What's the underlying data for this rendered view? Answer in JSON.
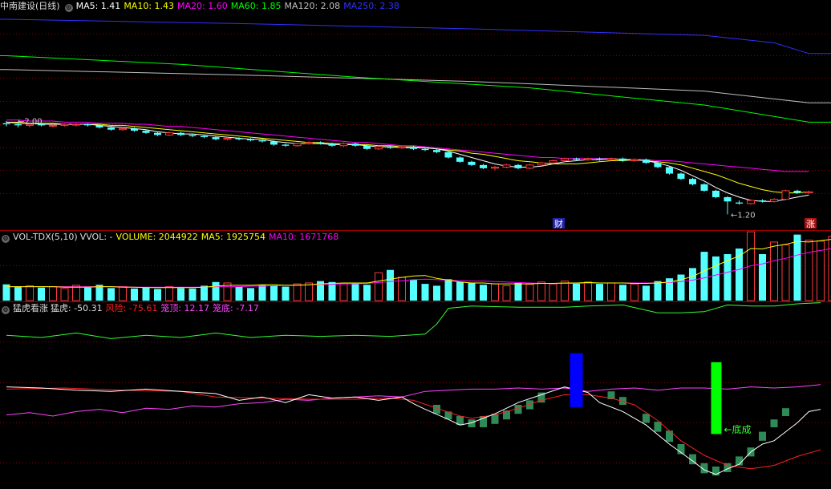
{
  "colors": {
    "up": "#ff3b3b",
    "down": "#54ffff",
    "ma5": "#ffffff",
    "ma10": "#ffff00",
    "ma20": "#ff00ff",
    "ma60": "#00ff00",
    "ma120": "#c0c0c0",
    "ma250": "#3030ff",
    "grid": "#8b0000",
    "risk": "#ff2020",
    "top": "#ff44ff",
    "bottom": "#30ff30",
    "tiger": "#ffffff",
    "bar_green": "#2e8b57",
    "blue_block": "#0000ff",
    "green_block": "#00ff00"
  },
  "price_panel": {
    "title": "中南建设(日线)",
    "ma_labels": [
      {
        "key": "ma5",
        "text": "MA5: 1.41"
      },
      {
        "key": "ma10",
        "text": "MA10: 1.43"
      },
      {
        "key": "ma20",
        "text": "MA20: 1.60"
      },
      {
        "key": "ma60",
        "text": "MA60: 1.85"
      },
      {
        "key": "ma120",
        "text": "MA120: 2.08"
      },
      {
        "key": "ma250",
        "text": "MA250: 2.38"
      }
    ],
    "high_label": "2.00",
    "low_label": "1.20",
    "marker_cai": "财",
    "marker_zhang": "涨",
    "ma250_line": [
      [
        0,
        3.02
      ],
      [
        20,
        2.98
      ],
      [
        40,
        2.93
      ],
      [
        60,
        2.87
      ],
      [
        66,
        2.8
      ],
      [
        69,
        2.7
      ]
    ],
    "ma120_line": [
      [
        0,
        2.55
      ],
      [
        20,
        2.5
      ],
      [
        40,
        2.44
      ],
      [
        60,
        2.35
      ],
      [
        69,
        2.24
      ]
    ],
    "ma60_line": [
      [
        0,
        2.68
      ],
      [
        15,
        2.6
      ],
      [
        30,
        2.48
      ],
      [
        45,
        2.38
      ],
      [
        60,
        2.22
      ],
      [
        69,
        2.06
      ]
    ],
    "candles": [
      [
        2.05,
        2.04,
        2.07,
        2.02
      ],
      [
        2.04,
        2.03,
        2.06,
        2.01
      ],
      [
        2.03,
        2.04,
        2.05,
        2.01
      ],
      [
        2.04,
        2.03,
        2.05,
        2.02
      ],
      [
        2.03,
        2.03,
        2.04,
        2.01
      ],
      [
        2.03,
        2.04,
        2.05,
        2.02
      ],
      [
        2.04,
        2.04,
        2.05,
        2.02
      ],
      [
        2.04,
        2.03,
        2.05,
        2.02
      ],
      [
        2.03,
        2.01,
        2.04,
        2.0
      ],
      [
        2.01,
        1.99,
        2.02,
        1.98
      ],
      [
        1.99,
        2.0,
        2.01,
        1.98
      ],
      [
        2.0,
        1.98,
        2.01,
        1.97
      ],
      [
        1.98,
        1.96,
        1.99,
        1.95
      ],
      [
        1.96,
        1.94,
        1.97,
        1.93
      ],
      [
        1.94,
        1.96,
        1.97,
        1.93
      ],
      [
        1.96,
        1.94,
        1.97,
        1.93
      ],
      [
        1.94,
        1.93,
        1.95,
        1.92
      ],
      [
        1.93,
        1.92,
        1.94,
        1.91
      ],
      [
        1.92,
        1.9,
        1.93,
        1.89
      ],
      [
        1.9,
        1.91,
        1.92,
        1.89
      ],
      [
        1.91,
        1.9,
        1.92,
        1.89
      ],
      [
        1.9,
        1.89,
        1.91,
        1.88
      ],
      [
        1.89,
        1.88,
        1.9,
        1.87
      ],
      [
        1.88,
        1.85,
        1.89,
        1.84
      ],
      [
        1.85,
        1.84,
        1.86,
        1.83
      ],
      [
        1.84,
        1.86,
        1.87,
        1.83
      ],
      [
        1.86,
        1.87,
        1.88,
        1.85
      ],
      [
        1.87,
        1.86,
        1.88,
        1.85
      ],
      [
        1.86,
        1.84,
        1.87,
        1.83
      ],
      [
        1.84,
        1.86,
        1.87,
        1.83
      ],
      [
        1.86,
        1.84,
        1.87,
        1.83
      ],
      [
        1.84,
        1.81,
        1.85,
        1.8
      ],
      [
        1.81,
        1.83,
        1.84,
        1.8
      ],
      [
        1.83,
        1.82,
        1.84,
        1.81
      ],
      [
        1.82,
        1.83,
        1.84,
        1.81
      ],
      [
        1.83,
        1.81,
        1.84,
        1.8
      ],
      [
        1.81,
        1.8,
        1.82,
        1.79
      ],
      [
        1.8,
        1.78,
        1.81,
        1.77
      ],
      [
        1.78,
        1.73,
        1.79,
        1.72
      ],
      [
        1.73,
        1.69,
        1.74,
        1.68
      ],
      [
        1.69,
        1.66,
        1.7,
        1.65
      ],
      [
        1.66,
        1.63,
        1.67,
        1.62
      ],
      [
        1.63,
        1.64,
        1.65,
        1.61
      ],
      [
        1.64,
        1.66,
        1.67,
        1.63
      ],
      [
        1.66,
        1.63,
        1.67,
        1.62
      ],
      [
        1.63,
        1.66,
        1.67,
        1.62
      ],
      [
        1.66,
        1.68,
        1.69,
        1.65
      ],
      [
        1.68,
        1.7,
        1.71,
        1.67
      ],
      [
        1.7,
        1.72,
        1.73,
        1.69
      ],
      [
        1.72,
        1.71,
        1.73,
        1.7
      ],
      [
        1.71,
        1.72,
        1.73,
        1.7
      ],
      [
        1.72,
        1.71,
        1.73,
        1.7
      ],
      [
        1.71,
        1.72,
        1.73,
        1.7
      ],
      [
        1.72,
        1.7,
        1.73,
        1.69
      ],
      [
        1.7,
        1.71,
        1.72,
        1.69
      ],
      [
        1.71,
        1.68,
        1.72,
        1.67
      ],
      [
        1.68,
        1.64,
        1.69,
        1.63
      ],
      [
        1.64,
        1.58,
        1.65,
        1.57
      ],
      [
        1.58,
        1.53,
        1.59,
        1.52
      ],
      [
        1.53,
        1.48,
        1.54,
        1.47
      ],
      [
        1.48,
        1.42,
        1.49,
        1.41
      ],
      [
        1.42,
        1.36,
        1.43,
        1.35
      ],
      [
        1.36,
        1.32,
        1.37,
        1.2
      ],
      [
        1.31,
        1.3,
        1.33,
        1.29
      ],
      [
        1.3,
        1.33,
        1.34,
        1.29
      ],
      [
        1.33,
        1.32,
        1.34,
        1.31
      ],
      [
        1.32,
        1.34,
        1.35,
        1.31
      ],
      [
        1.34,
        1.42,
        1.43,
        1.33
      ],
      [
        1.42,
        1.4,
        1.43,
        1.39
      ],
      [
        1.4,
        1.41,
        1.42,
        1.39
      ]
    ],
    "ma5": [
      2.06,
      2.05,
      2.05,
      2.04,
      2.04,
      2.04,
      2.04,
      2.04,
      2.03,
      2.02,
      2.01,
      2.0,
      1.99,
      1.97,
      1.96,
      1.95,
      1.95,
      1.94,
      1.93,
      1.92,
      1.91,
      1.9,
      1.9,
      1.88,
      1.87,
      1.86,
      1.86,
      1.86,
      1.85,
      1.85,
      1.85,
      1.84,
      1.83,
      1.83,
      1.82,
      1.82,
      1.82,
      1.81,
      1.79,
      1.76,
      1.73,
      1.7,
      1.67,
      1.65,
      1.64,
      1.64,
      1.65,
      1.67,
      1.69,
      1.7,
      1.71,
      1.71,
      1.72,
      1.71,
      1.71,
      1.7,
      1.68,
      1.65,
      1.61,
      1.56,
      1.51,
      1.45,
      1.4,
      1.36,
      1.33,
      1.32,
      1.32,
      1.34,
      1.36,
      1.38
    ],
    "ma10": [
      2.06,
      2.06,
      2.05,
      2.05,
      2.05,
      2.04,
      2.04,
      2.04,
      2.04,
      2.03,
      2.03,
      2.02,
      2.01,
      2.0,
      1.99,
      1.98,
      1.97,
      1.96,
      1.95,
      1.94,
      1.93,
      1.92,
      1.91,
      1.9,
      1.89,
      1.88,
      1.87,
      1.87,
      1.86,
      1.86,
      1.85,
      1.85,
      1.84,
      1.84,
      1.83,
      1.83,
      1.82,
      1.81,
      1.8,
      1.79,
      1.77,
      1.76,
      1.74,
      1.72,
      1.7,
      1.69,
      1.68,
      1.67,
      1.67,
      1.67,
      1.68,
      1.69,
      1.7,
      1.7,
      1.71,
      1.7,
      1.69,
      1.68,
      1.66,
      1.63,
      1.6,
      1.57,
      1.53,
      1.49,
      1.46,
      1.43,
      1.41,
      1.4,
      1.4,
      1.41
    ],
    "ma20": [
      2.08,
      2.08,
      2.07,
      2.07,
      2.07,
      2.06,
      2.06,
      2.06,
      2.05,
      2.05,
      2.05,
      2.04,
      2.04,
      2.03,
      2.02,
      2.02,
      2.01,
      2.0,
      1.99,
      1.98,
      1.97,
      1.96,
      1.95,
      1.94,
      1.93,
      1.92,
      1.91,
      1.9,
      1.89,
      1.88,
      1.87,
      1.87,
      1.86,
      1.85,
      1.84,
      1.84,
      1.83,
      1.82,
      1.81,
      1.8,
      1.79,
      1.78,
      1.77,
      1.76,
      1.75,
      1.74,
      1.73,
      1.73,
      1.72,
      1.72,
      1.72,
      1.72,
      1.72,
      1.71,
      1.71,
      1.71,
      1.7,
      1.7,
      1.69,
      1.68,
      1.67,
      1.66,
      1.65,
      1.64,
      1.63,
      1.62,
      1.61,
      1.6,
      1.6,
      1.6
    ]
  },
  "volume_panel": {
    "title": "VOL-TDX(5,10)",
    "labels": [
      {
        "key": "vvol",
        "text": "VVOL: -"
      },
      {
        "key": "volume",
        "text": "VOLUME: 2044922"
      },
      {
        "key": "vma5",
        "text": "MA5: 1925754"
      },
      {
        "key": "vma10",
        "text": "MA10: 1671768"
      }
    ],
    "bars": [
      0.35,
      0.3,
      0.32,
      0.28,
      0.3,
      0.26,
      0.33,
      0.28,
      0.34,
      0.27,
      0.3,
      0.26,
      0.28,
      0.25,
      0.3,
      0.27,
      0.26,
      0.32,
      0.4,
      0.38,
      0.3,
      0.27,
      0.34,
      0.32,
      0.3,
      0.36,
      0.38,
      0.42,
      0.4,
      0.36,
      0.38,
      0.34,
      0.6,
      0.66,
      0.5,
      0.45,
      0.36,
      0.32,
      0.46,
      0.4,
      0.38,
      0.34,
      0.36,
      0.32,
      0.38,
      0.35,
      0.4,
      0.36,
      0.42,
      0.38,
      0.4,
      0.36,
      0.38,
      0.34,
      0.36,
      0.32,
      0.42,
      0.48,
      0.56,
      0.7,
      1.05,
      0.95,
      1.0,
      1.12,
      1.48,
      1.0,
      1.26,
      1.2,
      1.42,
      1.3,
      1.28,
      1.38
    ],
    "vma5": [
      0.3,
      0.3,
      0.3,
      0.3,
      0.3,
      0.29,
      0.29,
      0.29,
      0.3,
      0.3,
      0.29,
      0.29,
      0.28,
      0.28,
      0.28,
      0.28,
      0.28,
      0.29,
      0.31,
      0.33,
      0.33,
      0.33,
      0.34,
      0.34,
      0.33,
      0.33,
      0.34,
      0.36,
      0.37,
      0.38,
      0.38,
      0.38,
      0.42,
      0.46,
      0.5,
      0.53,
      0.54,
      0.48,
      0.44,
      0.4,
      0.38,
      0.38,
      0.36,
      0.36,
      0.36,
      0.36,
      0.37,
      0.37,
      0.38,
      0.38,
      0.39,
      0.38,
      0.38,
      0.38,
      0.37,
      0.37,
      0.38,
      0.4,
      0.45,
      0.52,
      0.64,
      0.75,
      0.86,
      0.96,
      1.12,
      1.11,
      1.17,
      1.21,
      1.27,
      1.26,
      1.29,
      1.32
    ],
    "vma10": [
      0.3,
      0.3,
      0.3,
      0.3,
      0.3,
      0.3,
      0.3,
      0.3,
      0.3,
      0.3,
      0.3,
      0.29,
      0.29,
      0.29,
      0.29,
      0.29,
      0.29,
      0.29,
      0.3,
      0.3,
      0.3,
      0.31,
      0.31,
      0.32,
      0.33,
      0.33,
      0.34,
      0.35,
      0.35,
      0.36,
      0.36,
      0.37,
      0.39,
      0.41,
      0.43,
      0.45,
      0.46,
      0.45,
      0.44,
      0.43,
      0.42,
      0.42,
      0.41,
      0.4,
      0.39,
      0.38,
      0.37,
      0.37,
      0.37,
      0.37,
      0.38,
      0.38,
      0.38,
      0.38,
      0.38,
      0.38,
      0.38,
      0.39,
      0.41,
      0.44,
      0.49,
      0.55,
      0.61,
      0.67,
      0.75,
      0.79,
      0.86,
      0.91,
      0.98,
      1.04,
      1.08,
      1.12
    ]
  },
  "tiger_panel": {
    "title": "猛虎看涨",
    "labels": [
      {
        "key": "tiger",
        "text": "猛虎: -50.31"
      },
      {
        "key": "risk",
        "text": "风险: -75.61"
      },
      {
        "key": "top",
        "text": "笼顶: 12.17"
      },
      {
        "key": "bottom",
        "text": "笼底: -7.17"
      }
    ],
    "bottom_label": "底成",
    "top_line": [
      [
        0,
        42
      ],
      [
        3,
        40
      ],
      [
        6,
        44
      ],
      [
        9,
        39
      ],
      [
        12,
        42
      ],
      [
        15,
        40
      ],
      [
        18,
        44
      ],
      [
        21,
        40
      ],
      [
        24,
        42
      ],
      [
        27,
        41
      ],
      [
        30,
        42
      ],
      [
        33,
        41
      ],
      [
        36,
        43
      ],
      [
        37,
        52
      ],
      [
        38,
        66
      ],
      [
        40,
        68
      ],
      [
        44,
        67
      ],
      [
        48,
        67
      ],
      [
        50,
        68
      ],
      [
        53,
        69
      ],
      [
        56,
        62
      ],
      [
        58,
        62
      ],
      [
        60,
        63
      ],
      [
        62,
        69
      ],
      [
        64,
        68
      ],
      [
        66,
        68
      ],
      [
        68,
        70
      ],
      [
        70,
        71
      ]
    ],
    "risk_line": [
      [
        0,
        -6
      ],
      [
        5,
        -5
      ],
      [
        10,
        -7
      ],
      [
        15,
        -8
      ],
      [
        18,
        -13
      ],
      [
        22,
        -14
      ],
      [
        26,
        -15
      ],
      [
        30,
        -15
      ],
      [
        33,
        -14
      ],
      [
        35,
        -16
      ],
      [
        37,
        -23
      ],
      [
        39,
        -30
      ],
      [
        40,
        -32
      ],
      [
        42,
        -29
      ],
      [
        44,
        -23
      ],
      [
        46,
        -16
      ],
      [
        48,
        -11
      ],
      [
        50,
        -11
      ],
      [
        52,
        -14
      ],
      [
        54,
        -20
      ],
      [
        56,
        -34
      ],
      [
        58,
        -52
      ],
      [
        60,
        -65
      ],
      [
        62,
        -74
      ],
      [
        64,
        -77
      ],
      [
        66,
        -74
      ],
      [
        68,
        -66
      ],
      [
        70,
        -60
      ]
    ],
    "tiger_line": [
      [
        0,
        -4
      ],
      [
        3,
        -5
      ],
      [
        6,
        -7
      ],
      [
        9,
        -8
      ],
      [
        12,
        -6
      ],
      [
        15,
        -8
      ],
      [
        18,
        -10
      ],
      [
        20,
        -16
      ],
      [
        22,
        -13
      ],
      [
        24,
        -18
      ],
      [
        26,
        -11
      ],
      [
        28,
        -14
      ],
      [
        30,
        -13
      ],
      [
        32,
        -16
      ],
      [
        34,
        -13
      ],
      [
        35,
        -19
      ],
      [
        36,
        -24
      ],
      [
        38,
        -33
      ],
      [
        39,
        -38
      ],
      [
        40,
        -36
      ],
      [
        42,
        -28
      ],
      [
        44,
        -18
      ],
      [
        46,
        -11
      ],
      [
        48,
        -4
      ],
      [
        50,
        -9
      ],
      [
        51,
        -18
      ],
      [
        53,
        -26
      ],
      [
        55,
        -38
      ],
      [
        57,
        -55
      ],
      [
        59,
        -70
      ],
      [
        60,
        -78
      ],
      [
        61,
        -82
      ],
      [
        62,
        -77
      ],
      [
        63,
        -73
      ],
      [
        64,
        -62
      ],
      [
        65,
        -55
      ],
      [
        66,
        -52
      ],
      [
        67,
        -44
      ],
      [
        68,
        -36
      ],
      [
        69,
        -26
      ],
      [
        70,
        -24
      ]
    ],
    "bottom_line": [
      [
        0,
        -29
      ],
      [
        2,
        -27
      ],
      [
        4,
        -30
      ],
      [
        6,
        -26
      ],
      [
        8,
        -24
      ],
      [
        10,
        -27
      ],
      [
        12,
        -23
      ],
      [
        14,
        -24
      ],
      [
        16,
        -21
      ],
      [
        18,
        -22
      ],
      [
        20,
        -19
      ],
      [
        22,
        -18
      ],
      [
        24,
        -15
      ],
      [
        26,
        -16
      ],
      [
        28,
        -14
      ],
      [
        30,
        -13
      ],
      [
        32,
        -12
      ],
      [
        34,
        -13
      ],
      [
        36,
        -8
      ],
      [
        38,
        -7
      ],
      [
        40,
        -6
      ],
      [
        42,
        -6
      ],
      [
        44,
        -5
      ],
      [
        46,
        -6
      ],
      [
        48,
        -5
      ],
      [
        50,
        -8
      ],
      [
        52,
        -6
      ],
      [
        54,
        -5
      ],
      [
        56,
        -7
      ],
      [
        58,
        -5
      ],
      [
        60,
        -5
      ],
      [
        62,
        -6
      ],
      [
        64,
        -4
      ],
      [
        66,
        -5
      ],
      [
        68,
        -4
      ],
      [
        70,
        -2
      ]
    ],
    "green_bars": [
      [
        37,
        -20,
        -28
      ],
      [
        38,
        -26,
        -33
      ],
      [
        39,
        -30,
        -38
      ],
      [
        40,
        -33,
        -40
      ],
      [
        41,
        -30,
        -40
      ],
      [
        42,
        -28,
        -37
      ],
      [
        43,
        -25,
        -33
      ],
      [
        44,
        -20,
        -28
      ],
      [
        45,
        -16,
        -24
      ],
      [
        46,
        -9,
        -18
      ],
      [
        52,
        -8,
        -15
      ],
      [
        53,
        -13,
        -20
      ],
      [
        55,
        -28,
        -36
      ],
      [
        56,
        -35,
        -44
      ],
      [
        57,
        -43,
        -53
      ],
      [
        58,
        -55,
        -64
      ],
      [
        59,
        -64,
        -73
      ],
      [
        60,
        -72,
        -81
      ],
      [
        61,
        -75,
        -83
      ],
      [
        62,
        -72,
        -80
      ],
      [
        63,
        -66,
        -74
      ],
      [
        64,
        -58,
        -66
      ],
      [
        65,
        -44,
        -52
      ],
      [
        66,
        -33,
        -40
      ],
      [
        67,
        -23,
        -30
      ]
    ],
    "blue_block": {
      "index": 49,
      "hi": 12,
      "lo": -8
    },
    "green_block": {
      "index": 61,
      "hi": 15,
      "lo": -28
    }
  }
}
